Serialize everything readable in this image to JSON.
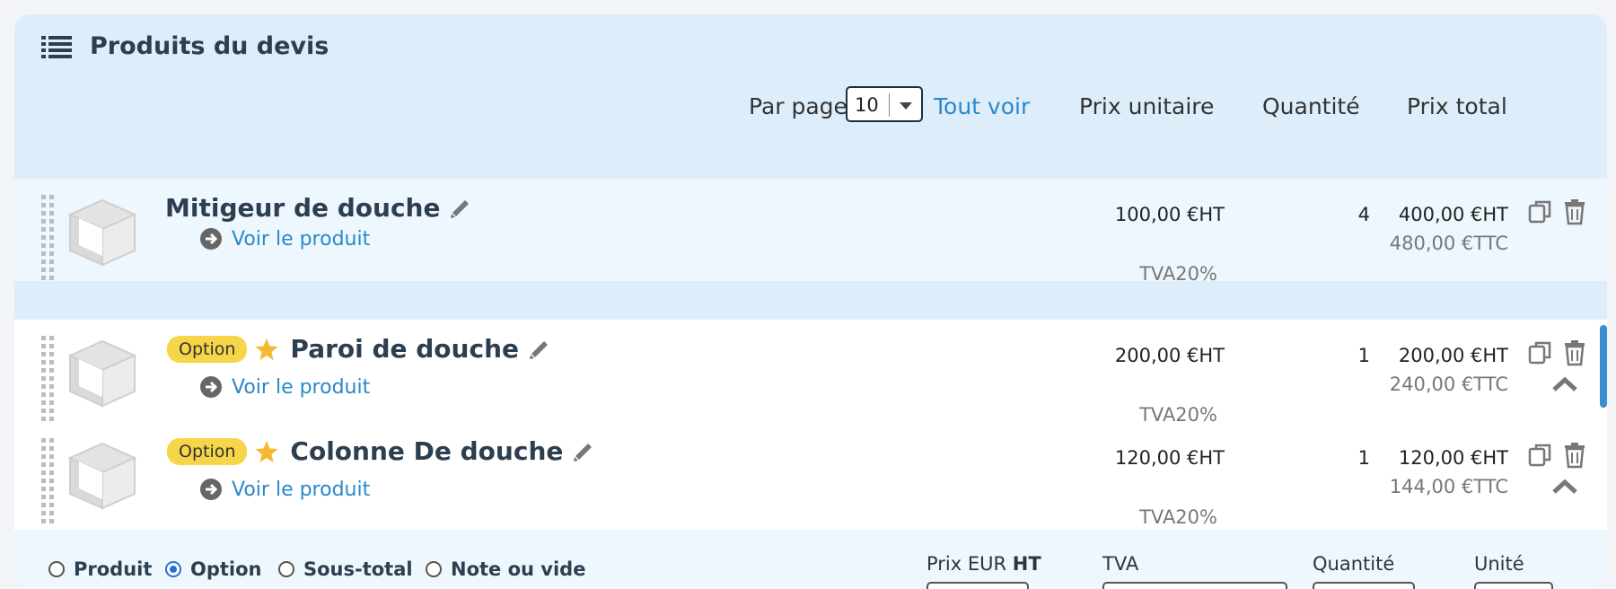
{
  "header": {
    "title": "Produits du devis"
  },
  "toolbar": {
    "per_page_label": "Par page",
    "per_page_value": "10",
    "see_all": "Tout voir",
    "col_unit_price": "Prix unitaire",
    "col_quantity": "Quantité",
    "col_total": "Prix total"
  },
  "items": [
    {
      "badge": "",
      "name": "Mitigeur de douche",
      "link": "Voir le produit",
      "unit_price": "100,00 €HT",
      "tva": "TVA20%",
      "quantity": "4",
      "total_ht": "400,00 €HT",
      "total_ttc": "480,00 €TTC"
    },
    {
      "badge": "Option",
      "name": "Paroi de douche",
      "link": "Voir le produit",
      "unit_price": "200,00 €HT",
      "tva": "TVA20%",
      "quantity": "1",
      "total_ht": "200,00 €HT",
      "total_ttc": "240,00 €TTC"
    },
    {
      "badge": "Option",
      "name": "Colonne De douche",
      "link": "Voir le produit",
      "unit_price": "120,00 €HT",
      "tva": "TVA20%",
      "quantity": "1",
      "total_ht": "120,00 €HT",
      "total_ttc": "144,00 €TTC"
    }
  ],
  "form": {
    "types": [
      "Produit",
      "Option",
      "Sous-total",
      "Note ou vide"
    ],
    "selected_type": "Option",
    "price_label_prefix": "Prix EUR ",
    "price_label_strong": "HT",
    "tva_label": "TVA",
    "quantity_label": "Quantité",
    "unit_label": "Unité"
  }
}
